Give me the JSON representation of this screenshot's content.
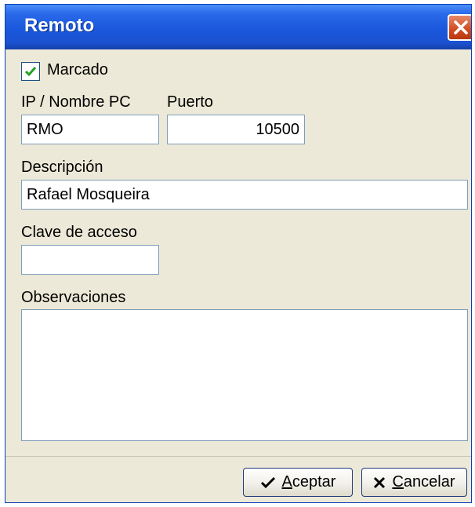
{
  "window": {
    "title": "Remoto"
  },
  "form": {
    "marcado_label": "Marcado",
    "marcado_checked": true,
    "ip_label": "IP / Nombre PC",
    "ip_value": "RMO",
    "puerto_label": "Puerto",
    "puerto_value": "10500",
    "descripcion_label": "Descripción",
    "descripcion_value": "Rafael Mosqueira",
    "clave_label": "Clave de acceso",
    "clave_value": "",
    "observaciones_label": "Observaciones",
    "observaciones_value": ""
  },
  "buttons": {
    "aceptar_mnemonic": "A",
    "aceptar_rest": "ceptar",
    "cancelar_mnemonic": "C",
    "cancelar_rest": "ancelar"
  },
  "icons": {
    "close": "close-icon",
    "check": "checkmark-icon",
    "aceptar": "checkmark-icon",
    "cancelar": "x-icon"
  },
  "colors": {
    "title_bar": "#1b52d1",
    "window_bg": "#ece9d8",
    "close_button": "#d24a20",
    "checkmark": "#21a121"
  }
}
